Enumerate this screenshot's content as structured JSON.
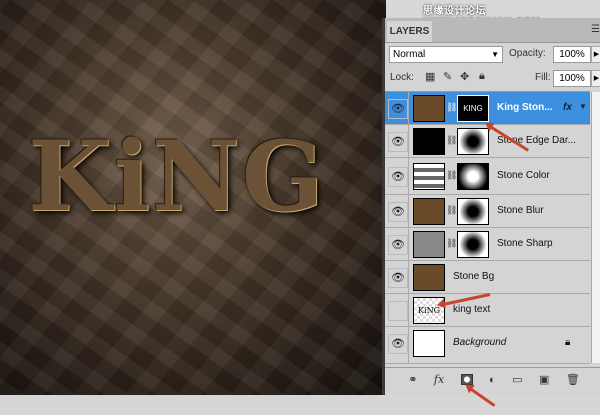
{
  "watermark": "思缘设计论坛 WWW.MISSYUAN.COM",
  "canvas_text": "KiNG",
  "panel": {
    "tab": "LAYERS",
    "blend_mode": "Normal",
    "opacity_label": "Opacity:",
    "opacity": "100%",
    "lock_label": "Lock:",
    "fill_label": "Fill:",
    "fill": "100%"
  },
  "layers": [
    {
      "name": "King Ston...",
      "visible": true,
      "selected": true,
      "fx": "fx",
      "mask_text": "KING"
    },
    {
      "name": "Stone Edge Dar...",
      "visible": true
    },
    {
      "name": "Stone Color",
      "visible": true
    },
    {
      "name": "Stone Blur",
      "visible": true
    },
    {
      "name": "Stone Sharp",
      "visible": true
    },
    {
      "name": "Stone Bg",
      "visible": true
    },
    {
      "name": "king text",
      "visible": false,
      "thumb_text": "KiNG"
    },
    {
      "name": "Background",
      "visible": true,
      "locked": true
    }
  ],
  "footer_icons": [
    "link-icon",
    "fx-icon",
    "add-mask-icon",
    "adjustment-icon",
    "group-icon",
    "new-layer-icon",
    "trash-icon"
  ],
  "footer_fx": "fx"
}
